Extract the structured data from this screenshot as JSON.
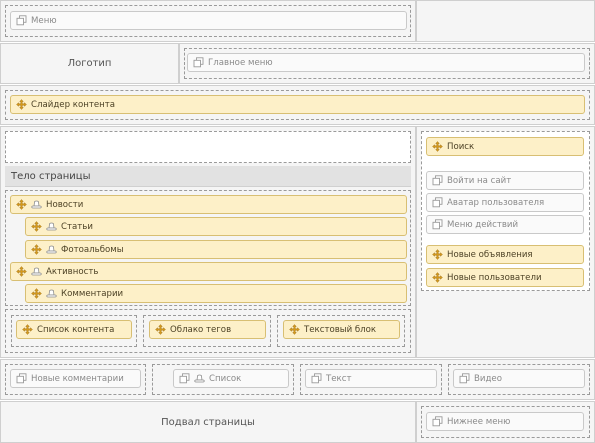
{
  "header": {
    "menu_label": "Меню",
    "logo_label": "Логотип",
    "main_menu_label": "Главное меню"
  },
  "slider": {
    "label": "Слайдер контента"
  },
  "body": {
    "title": "Тело страницы",
    "blocks": {
      "news": "Новости",
      "articles": "Статьи",
      "photo_albums": "Фотоальбомы",
      "activity": "Активность",
      "comments": "Комментарии"
    },
    "bottom": {
      "content_list": "Список контента",
      "tag_cloud": "Облако тегов",
      "text_block": "Текстовый блок"
    }
  },
  "sidebar": {
    "search": "Поиск",
    "login": "Войти на сайт",
    "user_avatar": "Аватар пользователя",
    "action_menu": "Меню действий",
    "new_ads": "Новые объявления",
    "new_users": "Новые пользователи"
  },
  "footer_row": {
    "new_comments": "Новые комментарии",
    "list": "Список",
    "text": "Текст",
    "video": "Видео"
  },
  "footer": {
    "label": "Подвал страницы",
    "bottom_menu": "Нижнее меню"
  },
  "icons": {
    "move": "move-arrows-icon",
    "copy": "copy-pages-icon",
    "hat": "hat-icon"
  },
  "colors": {
    "block_yellow": "#fdf0c8",
    "block_yellow_border": "#d8bf73",
    "block_gray": "#fafafa",
    "icon_orange": "#c8901e"
  }
}
